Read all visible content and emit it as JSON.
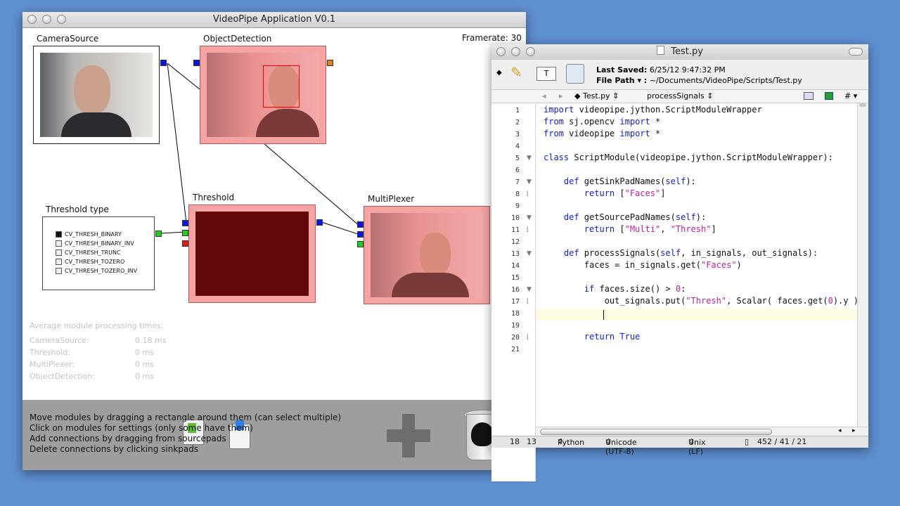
{
  "vp": {
    "title": "VideoPipe Application V0.1",
    "framerate": "Framerate: 30",
    "modules": {
      "camera": "CameraSource",
      "objdet": "ObjectDetection",
      "threshold": "Threshold",
      "multiplexer": "MultiPlexer",
      "threshtype": "Threshold type"
    },
    "thresh_options": [
      "CV_THRESH_BINARY",
      "CV_THRESH_BINARY_INV",
      "CV_THRESH_TRUNC",
      "CV_THRESH_TOZERO",
      "CV_THRESH_TOZERO_INV"
    ],
    "stats": {
      "heading": "Average module processing times:",
      "rows": [
        {
          "name": "CameraSource:",
          "value": "0.18 ms"
        },
        {
          "name": "Threshold:",
          "value": "0 ms"
        },
        {
          "name": "MultiPlexer:",
          "value": "0 ms"
        },
        {
          "name": "ObjectDetection:",
          "value": "0 ms"
        }
      ]
    },
    "help": [
      "Move modules by dragging a rectangle around them (can select multiple)",
      "Click on modules for settings (only some have them)",
      "Add connections by dragging from sourcepads",
      "Delete connections by clicking sinkpads"
    ]
  },
  "editor": {
    "title": "Test.py",
    "last_saved_label": "Last Saved:",
    "last_saved": "6/25/12 9:47:32 PM",
    "file_path_label": "File Path ▾ :",
    "file_path": "~/Documents/VideoPipe/Scripts/Test.py",
    "nav_file": "Test.py",
    "nav_func": "processSignals",
    "nav_hash": "#",
    "status": {
      "line": "18",
      "col": "13",
      "lang": "Python",
      "encoding": "Unicode (UTF-8)",
      "lineend": "Unix (LF)",
      "counts": "452 / 41 / 21"
    },
    "lines": [
      "1",
      "2",
      "3",
      "4",
      "5",
      "6",
      "7",
      "8",
      "9",
      "10",
      "11",
      "12",
      "13",
      "14",
      "15",
      "16",
      "17",
      "18",
      "19",
      "20",
      "21"
    ],
    "code": {
      "l1a": "import",
      "l1b": " videopipe.jython.ScriptModuleWrapper",
      "l2a": "from",
      "l2b": " sj.opencv ",
      "l2c": "import",
      "l2d": " *",
      "l3a": "from",
      "l3b": " videopipe ",
      "l3c": "import",
      "l3d": " *",
      "l5a": "class",
      "l5b": " ScriptModule(videopipe.jython.ScriptModuleWrapper):",
      "l7a": "    def",
      "l7b": " getSinkPadNames(",
      "l7c": "self",
      "l7d": "):",
      "l8a": "        return",
      "l8b": " [",
      "l8c": "\"Faces\"",
      "l8d": "]",
      "l10a": "    def",
      "l10b": " getSourcePadNames(",
      "l10c": "self",
      "l10d": "):",
      "l11a": "        return",
      "l11b": " [",
      "l11c": "\"Multi\"",
      "l11d": ", ",
      "l11e": "\"Thresh\"",
      "l11f": "]",
      "l13a": "    def",
      "l13b": " processSignals(",
      "l13c": "self",
      "l13d": ", in_signals, out_signals):",
      "l14a": "        faces = in_signals.get(",
      "l14b": "\"Faces\"",
      "l14c": ")",
      "l16a": "        if",
      "l16b": " faces.size() > ",
      "l16c": "0",
      "l16d": ":",
      "l17a": "            out_signals.put(",
      "l17b": "\"Thresh\"",
      "l17c": ", Scalar( faces.get(",
      "l17d": "0",
      "l17e": ").y )",
      "l20a": "        return",
      "l20b": " True"
    }
  }
}
